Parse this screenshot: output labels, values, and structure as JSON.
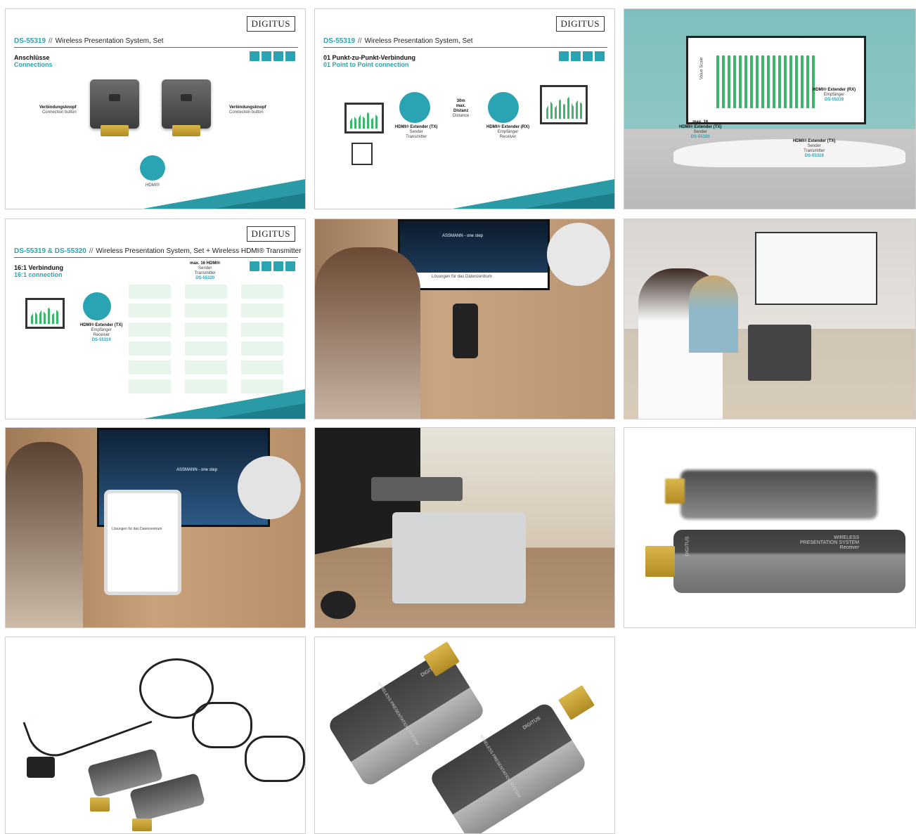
{
  "colors": {
    "accent": "#2aa3b3",
    "wedge": "#2a9aa6"
  },
  "slide1": {
    "code": "DS-55319",
    "separator": "//",
    "product": "Wireless Presentation System, Set",
    "logo": "DIGITUS",
    "heading": "Anschlüsse",
    "subheading": "Connections",
    "left_label_de": "Verbindungsknopf",
    "left_label_en": "Connection button",
    "right_label_de": "Verbindungsknopf",
    "right_label_en": "Connection button",
    "hdmi_label": "HDMI®"
  },
  "slide2": {
    "code": "DS-55319",
    "separator": "//",
    "product": "Wireless Presentation System, Set",
    "logo": "DIGITUS",
    "heading": "01 Punkt-zu-Punkt-Verbindung",
    "subheading": "01 Point to Point connection",
    "sender_title": "HDMI® Extender (TX)",
    "sender_de": "Sender",
    "sender_en": "Transmitter",
    "receiver_title": "HDMI® Extender (RX)",
    "receiver_de": "Empfänger",
    "receiver_en": "Receiver",
    "distance_value": "30m",
    "distance_max": "max.",
    "distance_de": "Distanz",
    "distance_en": "Distance"
  },
  "slide3": {
    "rx_title": "HDMI® Extender (RX)",
    "rx_de": "Empfänger",
    "rx_code": "DS-55319",
    "tx_max": "max. 16",
    "tx_title": "HDMI® Extender (TX)",
    "tx_de": "Sender",
    "tx_code": "DS-55320",
    "tx2_title": "HDMI® Extender (TX)",
    "tx2_de": "Sender",
    "tx2_en": "Transmitter",
    "tx2_code": "DS-55319",
    "chart_ylabel": "Value Scale"
  },
  "slide4": {
    "code": "DS-55319 & DS-55320",
    "separator": "//",
    "product": "Wireless Presentation System, Set + Wireless HDMI® Transmitter",
    "logo": "DIGITUS",
    "heading": "16:1 Verbindung",
    "subheading": "16:1 connection",
    "max_title": "max. 16 HDMI®",
    "max_de": "Sender",
    "max_en": "Transmitter",
    "max_code": "DS-55320",
    "rx_title": "HDMI® Extender (TX)",
    "rx_de": "Empfänger",
    "rx_en": "Receiver",
    "rx_code": "DS-55319"
  },
  "slide5": {
    "screen_text": "ASSMANN - one step",
    "screen_heading": "Lösungen für das Datenzentrum"
  },
  "slide7": {
    "screen_text": "ASSMANN - one step",
    "tablet_heading": "Lösungen für das Datenzentrum"
  },
  "slide9": {
    "brand": "DIGITUS",
    "line1": "WIRELESS",
    "line2": "PRESENTATION SYSTEM",
    "line3": "Receiver"
  },
  "slide11": {
    "brand1": "DIGITUS",
    "brand2": "DIGITUS",
    "text1": "WIRELESS PRESENTATION SYSTEM",
    "text2": "WIRELESS PRESENTATION SYSTEM"
  }
}
